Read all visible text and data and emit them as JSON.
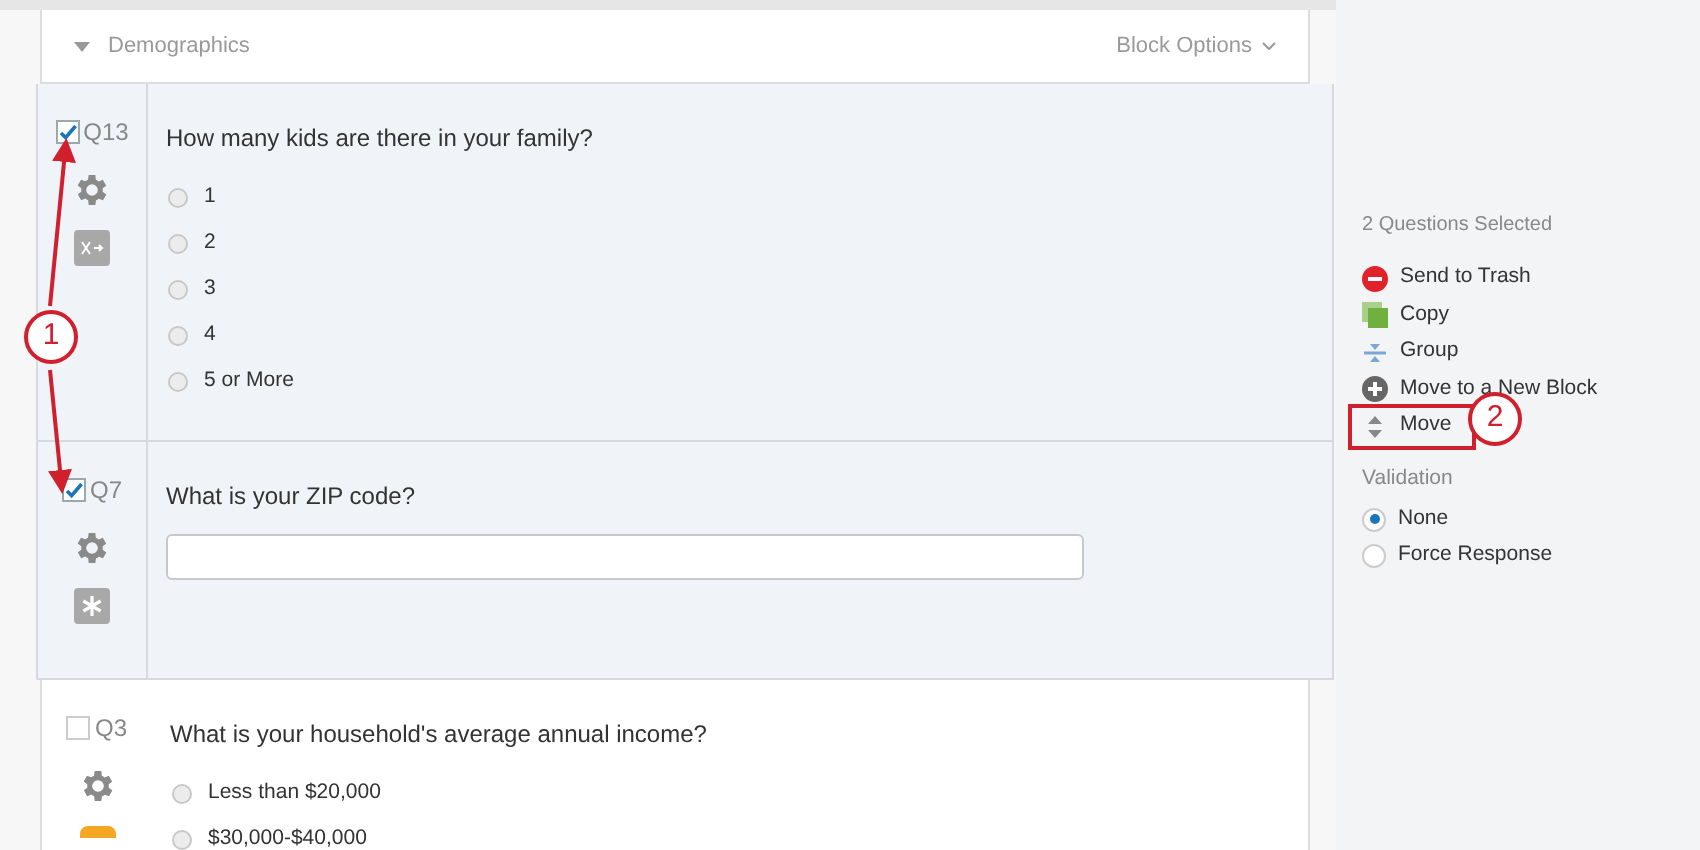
{
  "block": {
    "title": "Demographics",
    "options_label": "Block Options"
  },
  "questions": [
    {
      "number": "Q13",
      "selected": true,
      "kind": "choice",
      "badge": {
        "kind": "display-logic"
      },
      "text": "How many kids are there in your family?",
      "choices": [
        {
          "label": "1",
          "selected": false
        },
        {
          "label": "2",
          "selected": false
        },
        {
          "label": "3",
          "selected": false
        },
        {
          "label": "4",
          "selected": false
        },
        {
          "label": "5 or More",
          "selected": false
        }
      ]
    },
    {
      "number": "Q7",
      "selected": true,
      "kind": "text-entry",
      "badge": {
        "kind": "required"
      },
      "text": "What is your ZIP code?"
    },
    {
      "number": "Q3",
      "selected": false,
      "kind": "choice",
      "badge": {
        "kind": "orange"
      },
      "text": "What is your household's average annual income?",
      "choices": [
        {
          "label": "Less than $20,000",
          "selected": false
        },
        {
          "label": "$30,000-$40,000",
          "selected": false
        }
      ]
    }
  ],
  "panel": {
    "heading": "2 Questions Selected",
    "actions": [
      {
        "kind": "trash",
        "label": "Send to Trash"
      },
      {
        "kind": "copy",
        "label": "Copy"
      },
      {
        "kind": "group",
        "label": "Group"
      },
      {
        "kind": "new-block",
        "label": "Move to a New Block"
      },
      {
        "kind": "move",
        "label": "Move"
      }
    ],
    "validation_heading": "Validation",
    "validation": [
      {
        "label": "None",
        "selected": true
      },
      {
        "label": "Force Response",
        "selected": false
      }
    ]
  },
  "callouts": [
    "1",
    "2"
  ]
}
